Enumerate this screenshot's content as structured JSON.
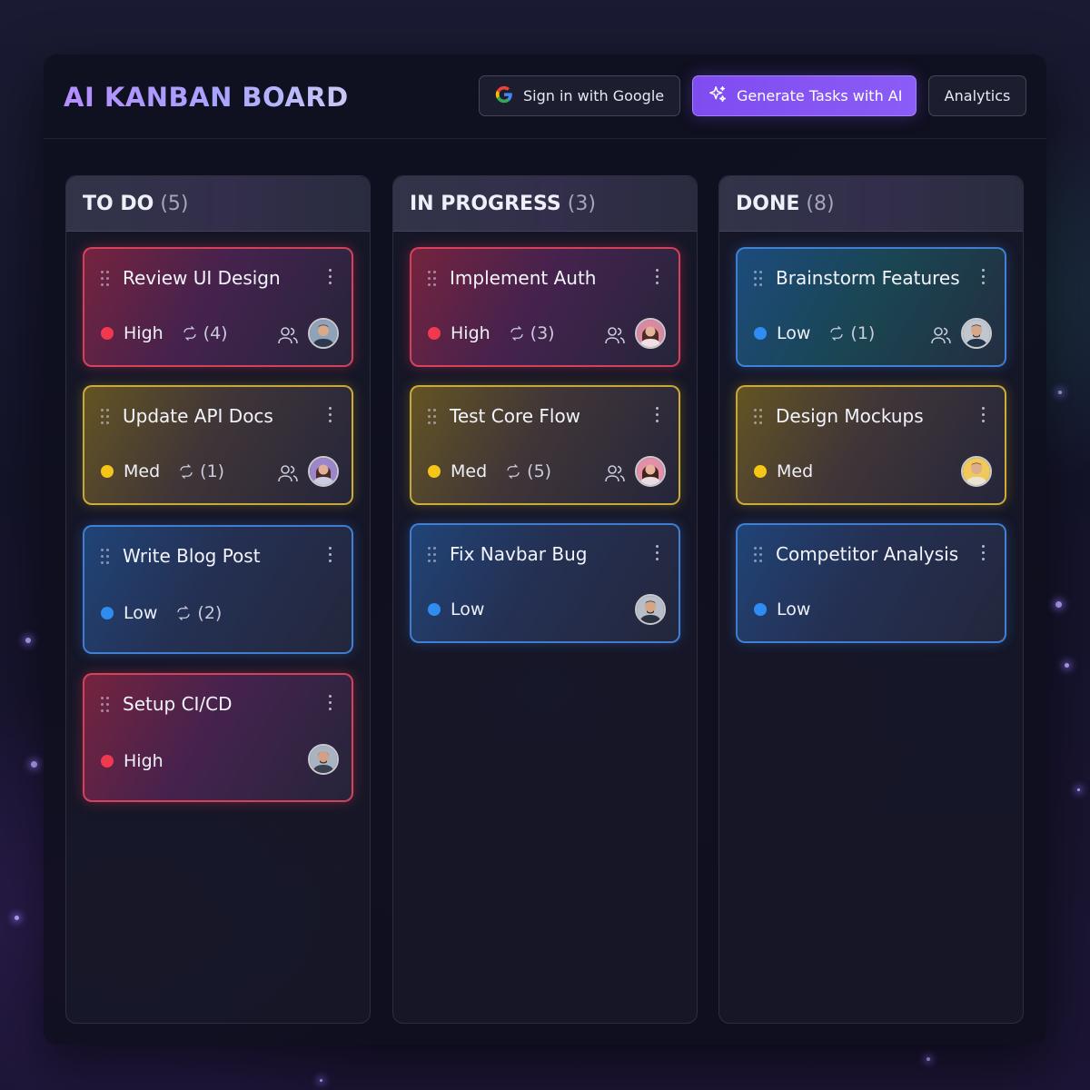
{
  "header": {
    "title": "AI KANBAN BOARD",
    "google_label": "Sign in with Google",
    "generate_label": "Generate Tasks with AI",
    "analytics_label": "Analytics"
  },
  "columns": [
    {
      "name": "TO DO",
      "count": "(5)",
      "cards": [
        {
          "title": "Review UI Design",
          "priority": "High",
          "subtasks": "(4)"
        },
        {
          "title": "Update API Docs",
          "priority": "Med",
          "subtasks": "(1)"
        },
        {
          "title": "Write Blog Post",
          "priority": "Low",
          "subtasks": "(2)"
        },
        {
          "title": "Setup CI/CD",
          "priority": "High"
        }
      ]
    },
    {
      "name": "IN PROGRESS",
      "count": "(3)",
      "cards": [
        {
          "title": "Implement Auth",
          "priority": "High",
          "subtasks": "(3)"
        },
        {
          "title": "Test Core Flow",
          "priority": "Med",
          "subtasks": "(5)"
        },
        {
          "title": "Fix Navbar Bug",
          "priority": "Low"
        }
      ]
    },
    {
      "name": "DONE",
      "count": "(8)",
      "cards": [
        {
          "title": "Brainstorm Features",
          "priority": "Low",
          "subtasks": "(1)"
        },
        {
          "title": "Design Mockups",
          "priority": "Med"
        },
        {
          "title": "Competitor Analysis",
          "priority": "Low"
        }
      ]
    }
  ],
  "colors": {
    "accent": "#8b5cf6",
    "high": "#f0384f",
    "med": "#f5c518",
    "low": "#2f8cf0"
  },
  "icons": {
    "google": "google-icon",
    "generate": "sparkle-icon",
    "drag": "drag-handle-icon",
    "menu": "kebab-menu-icon",
    "subtasks": "repeat-icon",
    "assignees": "users-icon"
  }
}
